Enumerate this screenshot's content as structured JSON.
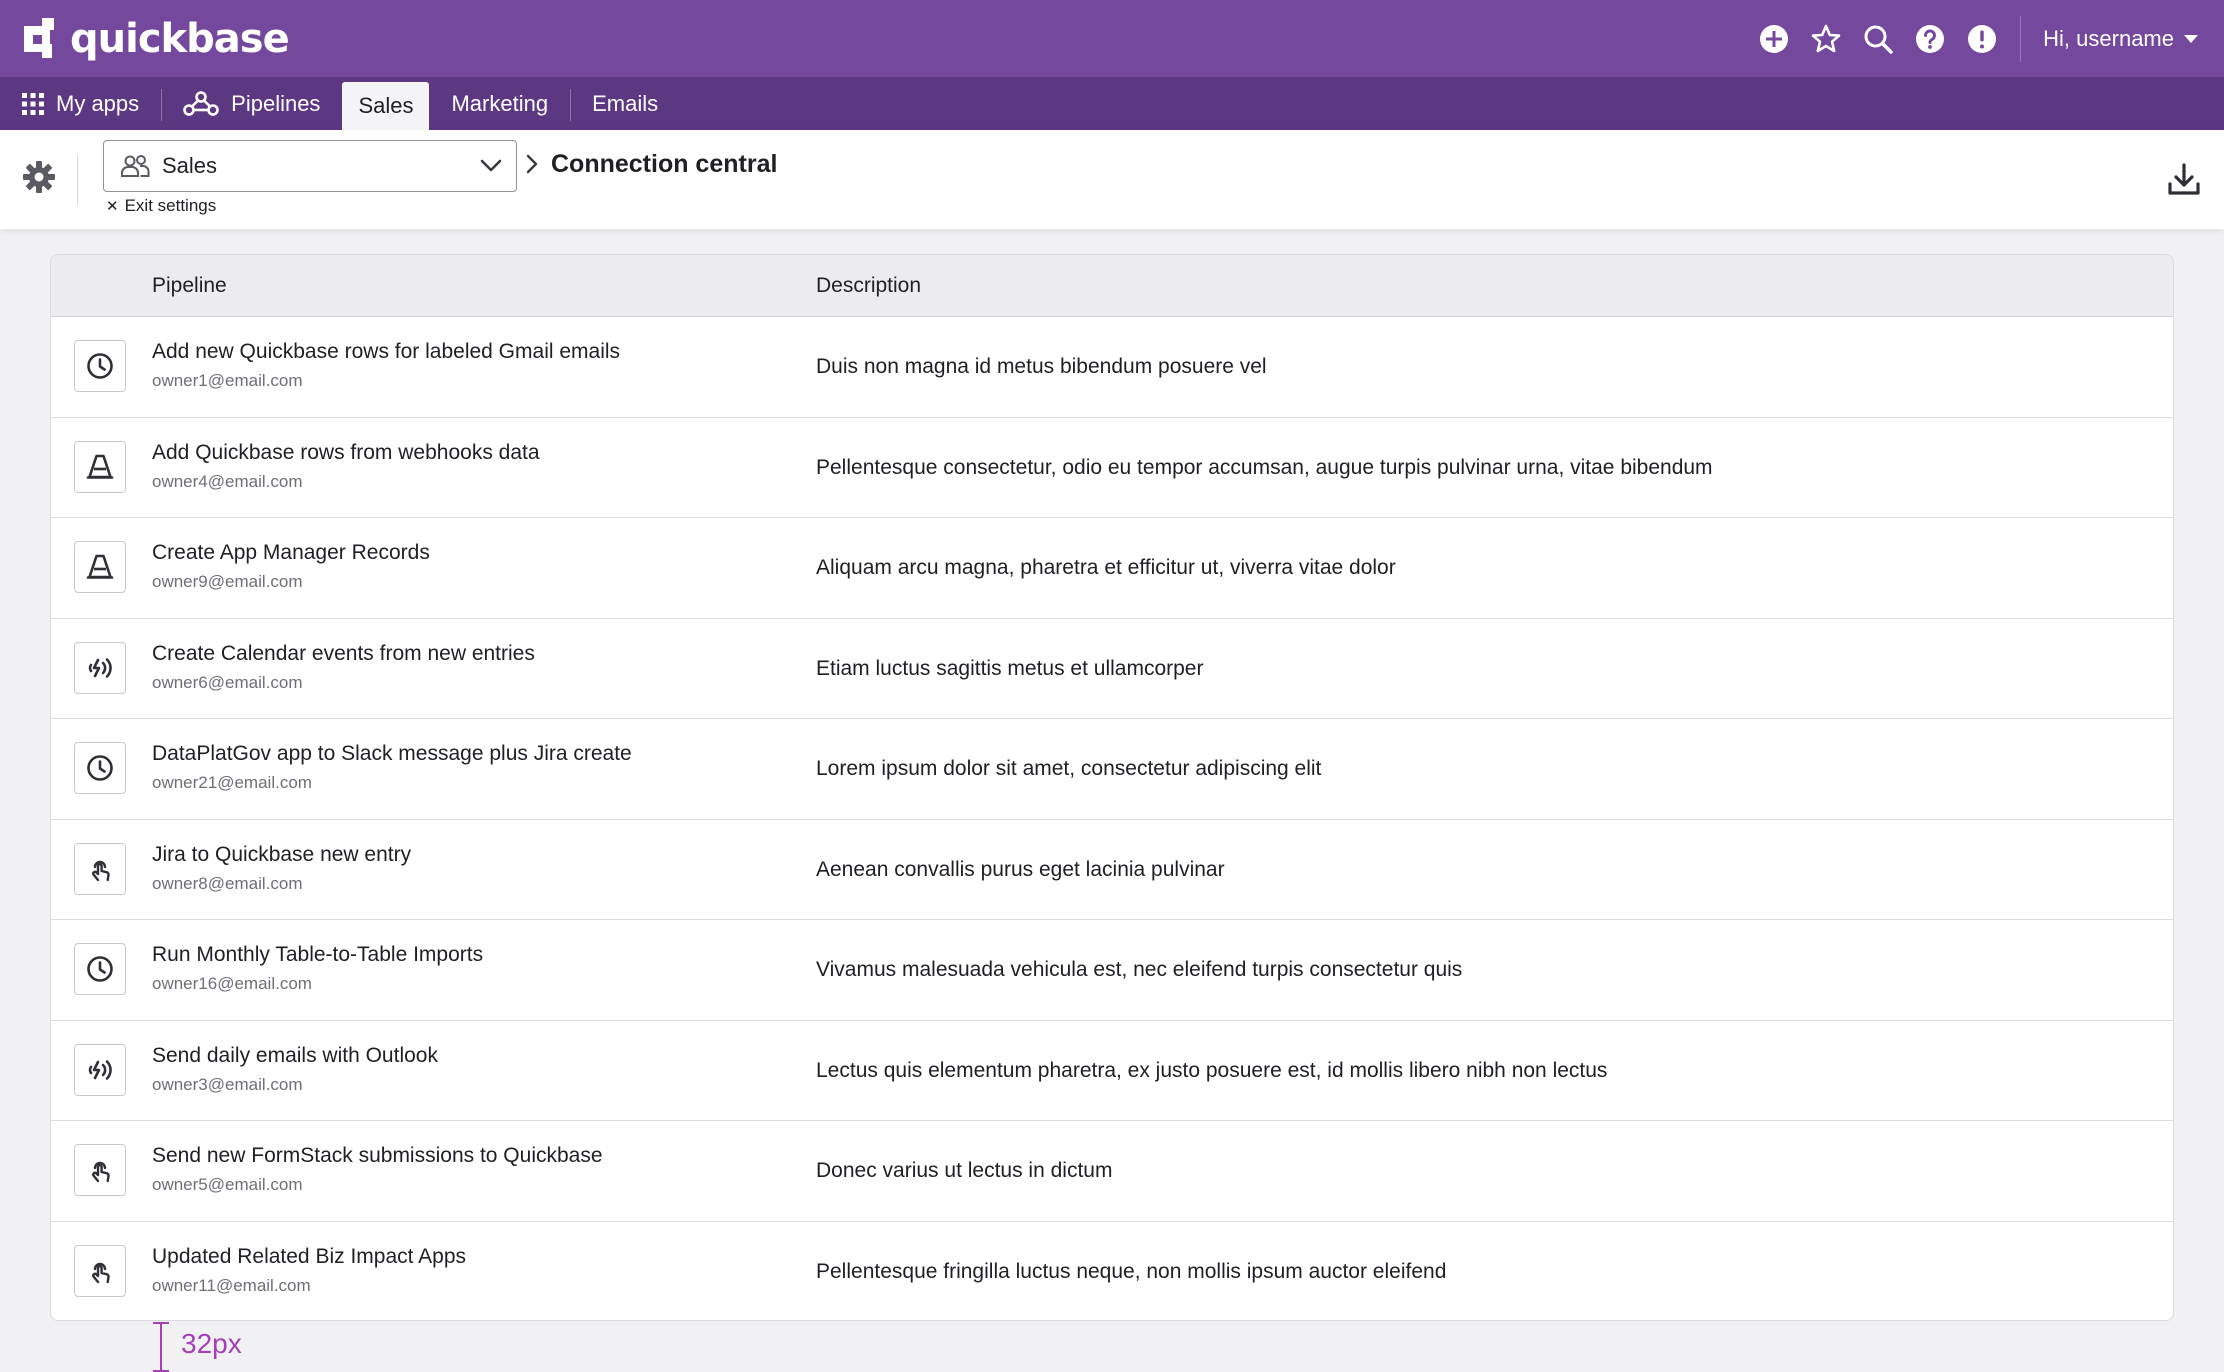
{
  "brand": {
    "name": "quickbase"
  },
  "header": {
    "user_greeting": "Hi, username",
    "icons": [
      "add-circle-icon",
      "star-icon",
      "search-icon",
      "help-icon",
      "alert-icon"
    ]
  },
  "nav": {
    "items": [
      {
        "label": "My apps",
        "icon": "grid-icon"
      },
      {
        "label": "Pipelines",
        "icon": "pipelines-icon"
      },
      {
        "label": "Sales",
        "active": true
      },
      {
        "label": "Marketing"
      },
      {
        "label": "Emails"
      }
    ]
  },
  "settings_bar": {
    "app_select": "Sales",
    "exit_label": "Exit settings",
    "title": "Connection central"
  },
  "table": {
    "columns": [
      "Pipeline",
      "Description"
    ],
    "rows": [
      {
        "icon": "clock-icon",
        "name": "Add new Quickbase rows for labeled Gmail emails",
        "owner": "owner1@email.com",
        "description": "Duis non magna id metus bibendum posuere vel"
      },
      {
        "icon": "cone-icon",
        "name": "Add Quickbase rows from webhooks data",
        "owner": "owner4@email.com",
        "description": "Pellentesque consectetur, odio eu tempor accumsan, augue turpis pulvinar urna, vitae bibendum"
      },
      {
        "icon": "cone-icon",
        "name": "Create App Manager Records",
        "owner": "owner9@email.com",
        "description": "Aliquam arcu magna, pharetra et efficitur ut, viverra vitae dolor"
      },
      {
        "icon": "signal-icon",
        "name": "Create Calendar events from new entries",
        "owner": "owner6@email.com",
        "description": "Etiam luctus sagittis metus et ullamcorper"
      },
      {
        "icon": "clock-icon",
        "name": "DataPlatGov app to Slack message plus Jira create",
        "owner": "owner21@email.com",
        "description": "Lorem ipsum dolor sit amet, consectetur adipiscing elit"
      },
      {
        "icon": "touch-icon",
        "name": "Jira to Quickbase new entry",
        "owner": "owner8@email.com",
        "description": "Aenean convallis purus eget lacinia pulvinar"
      },
      {
        "icon": "clock-icon",
        "name": "Run Monthly Table-to-Table Imports",
        "owner": "owner16@email.com",
        "description": "Vivamus malesuada vehicula est, nec eleifend turpis consectetur quis"
      },
      {
        "icon": "signal-icon",
        "name": "Send daily emails with Outlook",
        "owner": "owner3@email.com",
        "description": "Lectus quis elementum pharetra, ex justo posuere est, id mollis libero nibh non lectus"
      },
      {
        "icon": "touch-icon",
        "name": "Send new FormStack submissions to Quickbase",
        "owner": "owner5@email.com",
        "description": "Donec varius ut lectus in dictum"
      },
      {
        "icon": "touch-icon",
        "name": "Updated Related Biz Impact Apps",
        "owner": "owner11@email.com",
        "description": "Pellentesque fringilla luctus neque, non mollis ipsum auctor eleifend"
      }
    ]
  },
  "annotation": {
    "label": "32px"
  },
  "colors": {
    "brand_purple": "#74489d",
    "nav_purple": "#5c3782",
    "annotation": "#a43fb5"
  }
}
